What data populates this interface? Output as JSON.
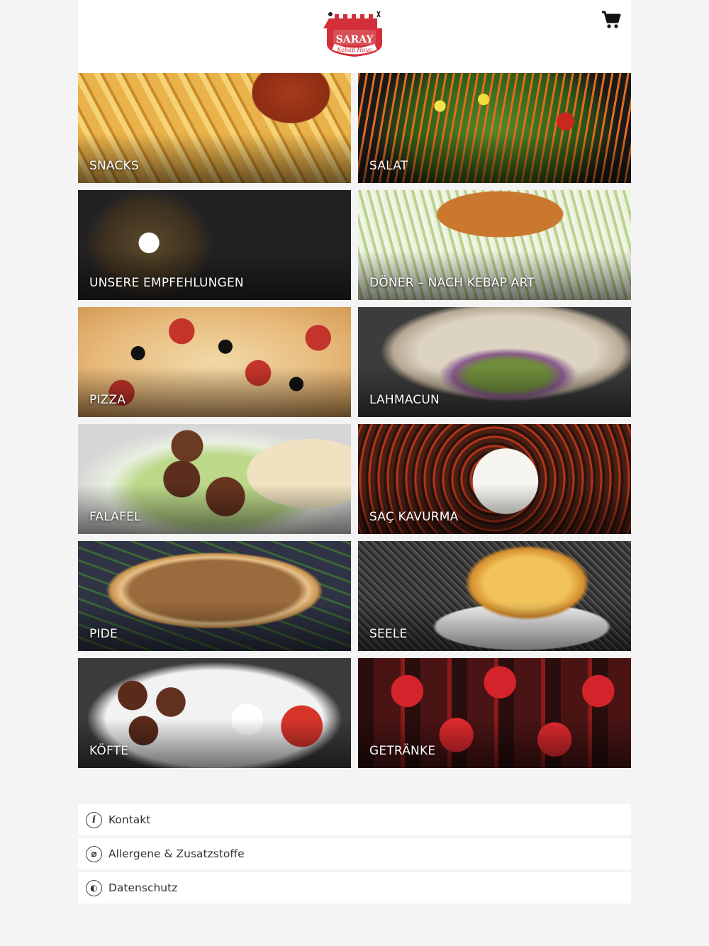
{
  "brand": {
    "logo_line1": "SARAY",
    "logo_line2": "Kebap Haus",
    "red": "#d32f3a"
  },
  "header": {
    "cart_icon": "shopping-cart-icon"
  },
  "categories": [
    {
      "label": "SNACKS"
    },
    {
      "label": "SALAT"
    },
    {
      "label": "UNSERE EMPFEHLUNGEN"
    },
    {
      "label": "DÖNER – NACH KEBAP ART"
    },
    {
      "label": "PIZZA"
    },
    {
      "label": "LAHMACUN"
    },
    {
      "label": "FALAFEL"
    },
    {
      "label": "SAÇ KAVURMA"
    },
    {
      "label": "PIDE"
    },
    {
      "label": "SEELE"
    },
    {
      "label": "KÖFTE"
    },
    {
      "label": "GETRÄNKE"
    }
  ],
  "footer_links": [
    {
      "label": "Kontakt",
      "icon": "info-icon",
      "glyph": "i"
    },
    {
      "label": "Allergene & Zusatzstoffe",
      "icon": "wheat-icon",
      "glyph": "⌀"
    },
    {
      "label": "Datenschutz",
      "icon": "privacy-icon",
      "glyph": "◐"
    }
  ]
}
